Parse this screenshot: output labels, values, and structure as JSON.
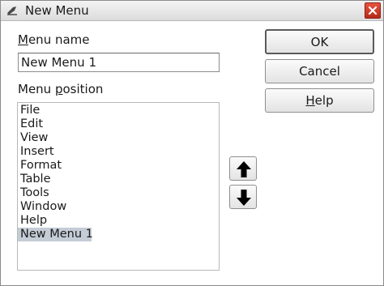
{
  "window": {
    "title": "New Menu"
  },
  "menu_name": {
    "label_mnemonic": "M",
    "label_rest": "enu name",
    "value": "New Menu 1"
  },
  "menu_position": {
    "label_before": "Menu ",
    "label_mnemonic": "p",
    "label_after": "osition",
    "items": [
      "File",
      "Edit",
      "View",
      "Insert",
      "Format",
      "Table",
      "Tools",
      "Window",
      "Help",
      "New Menu 1"
    ],
    "selected_index": 9
  },
  "buttons": {
    "ok": "OK",
    "cancel": "Cancel",
    "help_mnemonic": "H",
    "help_rest": "elp"
  },
  "icons": {
    "app": "app-icon",
    "close": "close-icon",
    "move_up": "arrow-up-icon",
    "move_down": "arrow-down-icon"
  },
  "colors": {
    "selection": "#c4ccd6",
    "close_button": "#c8392a"
  }
}
